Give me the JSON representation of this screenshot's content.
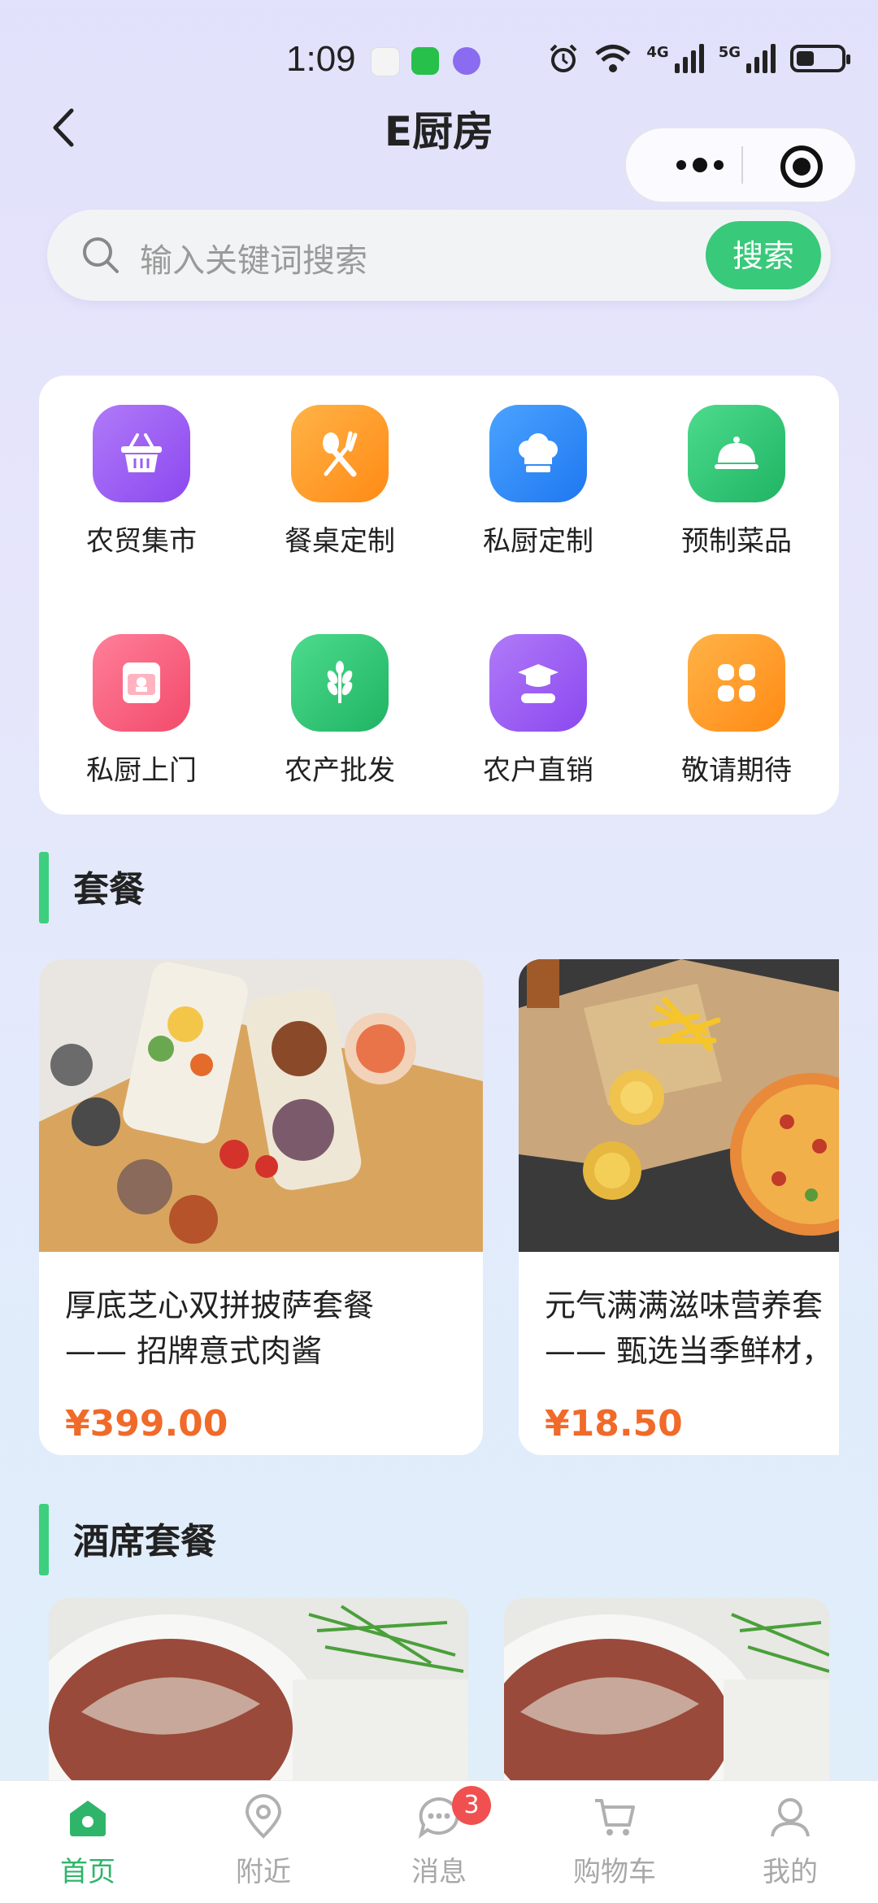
{
  "status_bar": {
    "time": "1:09",
    "network_1": "4G",
    "network_2": "5G",
    "battery_level": 0.4
  },
  "nav": {
    "title": "E厨房"
  },
  "search": {
    "placeholder": "输入关键词搜索",
    "button_label": "搜索"
  },
  "categories": [
    {
      "label": "农贸集市",
      "icon": "basket-icon",
      "color": "#9b5cf5"
    },
    {
      "label": "餐桌定制",
      "icon": "spoon-fork-icon",
      "color": "#ff9b26"
    },
    {
      "label": "私厨定制",
      "icon": "chef-hat-icon",
      "color": "#2f8cf8"
    },
    {
      "label": "预制菜品",
      "icon": "food-cloche-icon",
      "color": "#2cc474"
    },
    {
      "label": "私厨上门",
      "icon": "oven-icon",
      "color": "#f8627f"
    },
    {
      "label": "农产批发",
      "icon": "wheat-icon",
      "color": "#2cc474"
    },
    {
      "label": "农户直销",
      "icon": "farmer-icon",
      "color": "#9b5cf5"
    },
    {
      "label": "敬请期待",
      "icon": "grid-icon",
      "color": "#ff9b26"
    }
  ],
  "sections": {
    "combo_title": "套餐",
    "banquet_title": "酒席套餐"
  },
  "products": [
    {
      "line1": "厚底芝心双拼披萨套餐",
      "line2": "—— 招牌意式肉酱",
      "price": "¥399.00"
    },
    {
      "line1": "元气满满滋味营养套",
      "line2": "—— 甄选当季鲜材，",
      "price": "¥18.50"
    }
  ],
  "tabs": [
    {
      "label": "首页",
      "icon": "home-icon",
      "active": true
    },
    {
      "label": "附近",
      "icon": "location-pin-icon",
      "active": false
    },
    {
      "label": "消息",
      "icon": "chat-bubble-icon",
      "active": false,
      "badge": "3"
    },
    {
      "label": "购物车",
      "icon": "cart-icon",
      "active": false
    },
    {
      "label": "我的",
      "icon": "user-icon",
      "active": false
    }
  ],
  "colors": {
    "accent_green": "#38c97a",
    "price_orange": "#f06a2a",
    "badge_red": "#f0504f"
  }
}
